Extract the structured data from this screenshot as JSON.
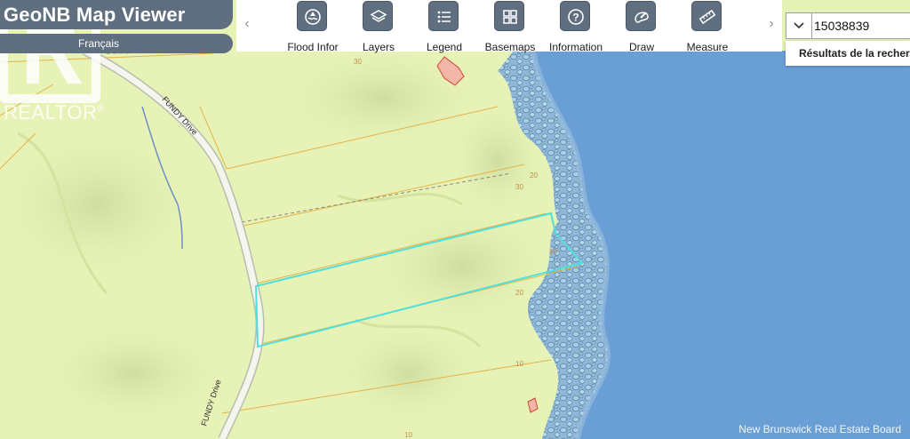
{
  "app": {
    "title": "GeoNB Map Viewer",
    "language_link": "Français"
  },
  "toolbar": {
    "prev_arrow": "‹",
    "next_arrow": "›",
    "tools": [
      {
        "label": "Flood Infor",
        "icon": "flood-icon"
      },
      {
        "label": "Layers",
        "icon": "layers-icon"
      },
      {
        "label": "Legend",
        "icon": "legend-icon"
      },
      {
        "label": "Basemaps",
        "icon": "basemaps-icon"
      },
      {
        "label": "Information",
        "icon": "information-icon"
      },
      {
        "label": "Draw",
        "icon": "draw-icon"
      },
      {
        "label": "Measure",
        "icon": "measure-icon"
      }
    ]
  },
  "search": {
    "value": "15038839",
    "results_label": "Résultats de la recherche"
  },
  "realtor": {
    "text": "REALTOR",
    "registered": "®"
  },
  "map": {
    "road_name": "FUNDY Drive",
    "contour_labels": [
      "30",
      "20",
      "30",
      "30",
      "20",
      "10",
      "10"
    ]
  },
  "watermark": "New Brunswick Real Estate Board",
  "colors": {
    "land": "#e7f3b8",
    "water": "#6b9fd6",
    "parcel_highlight": "#4fe0dc",
    "property_lines": "#e2b24a",
    "toolbar_button": "#5f6f80"
  }
}
